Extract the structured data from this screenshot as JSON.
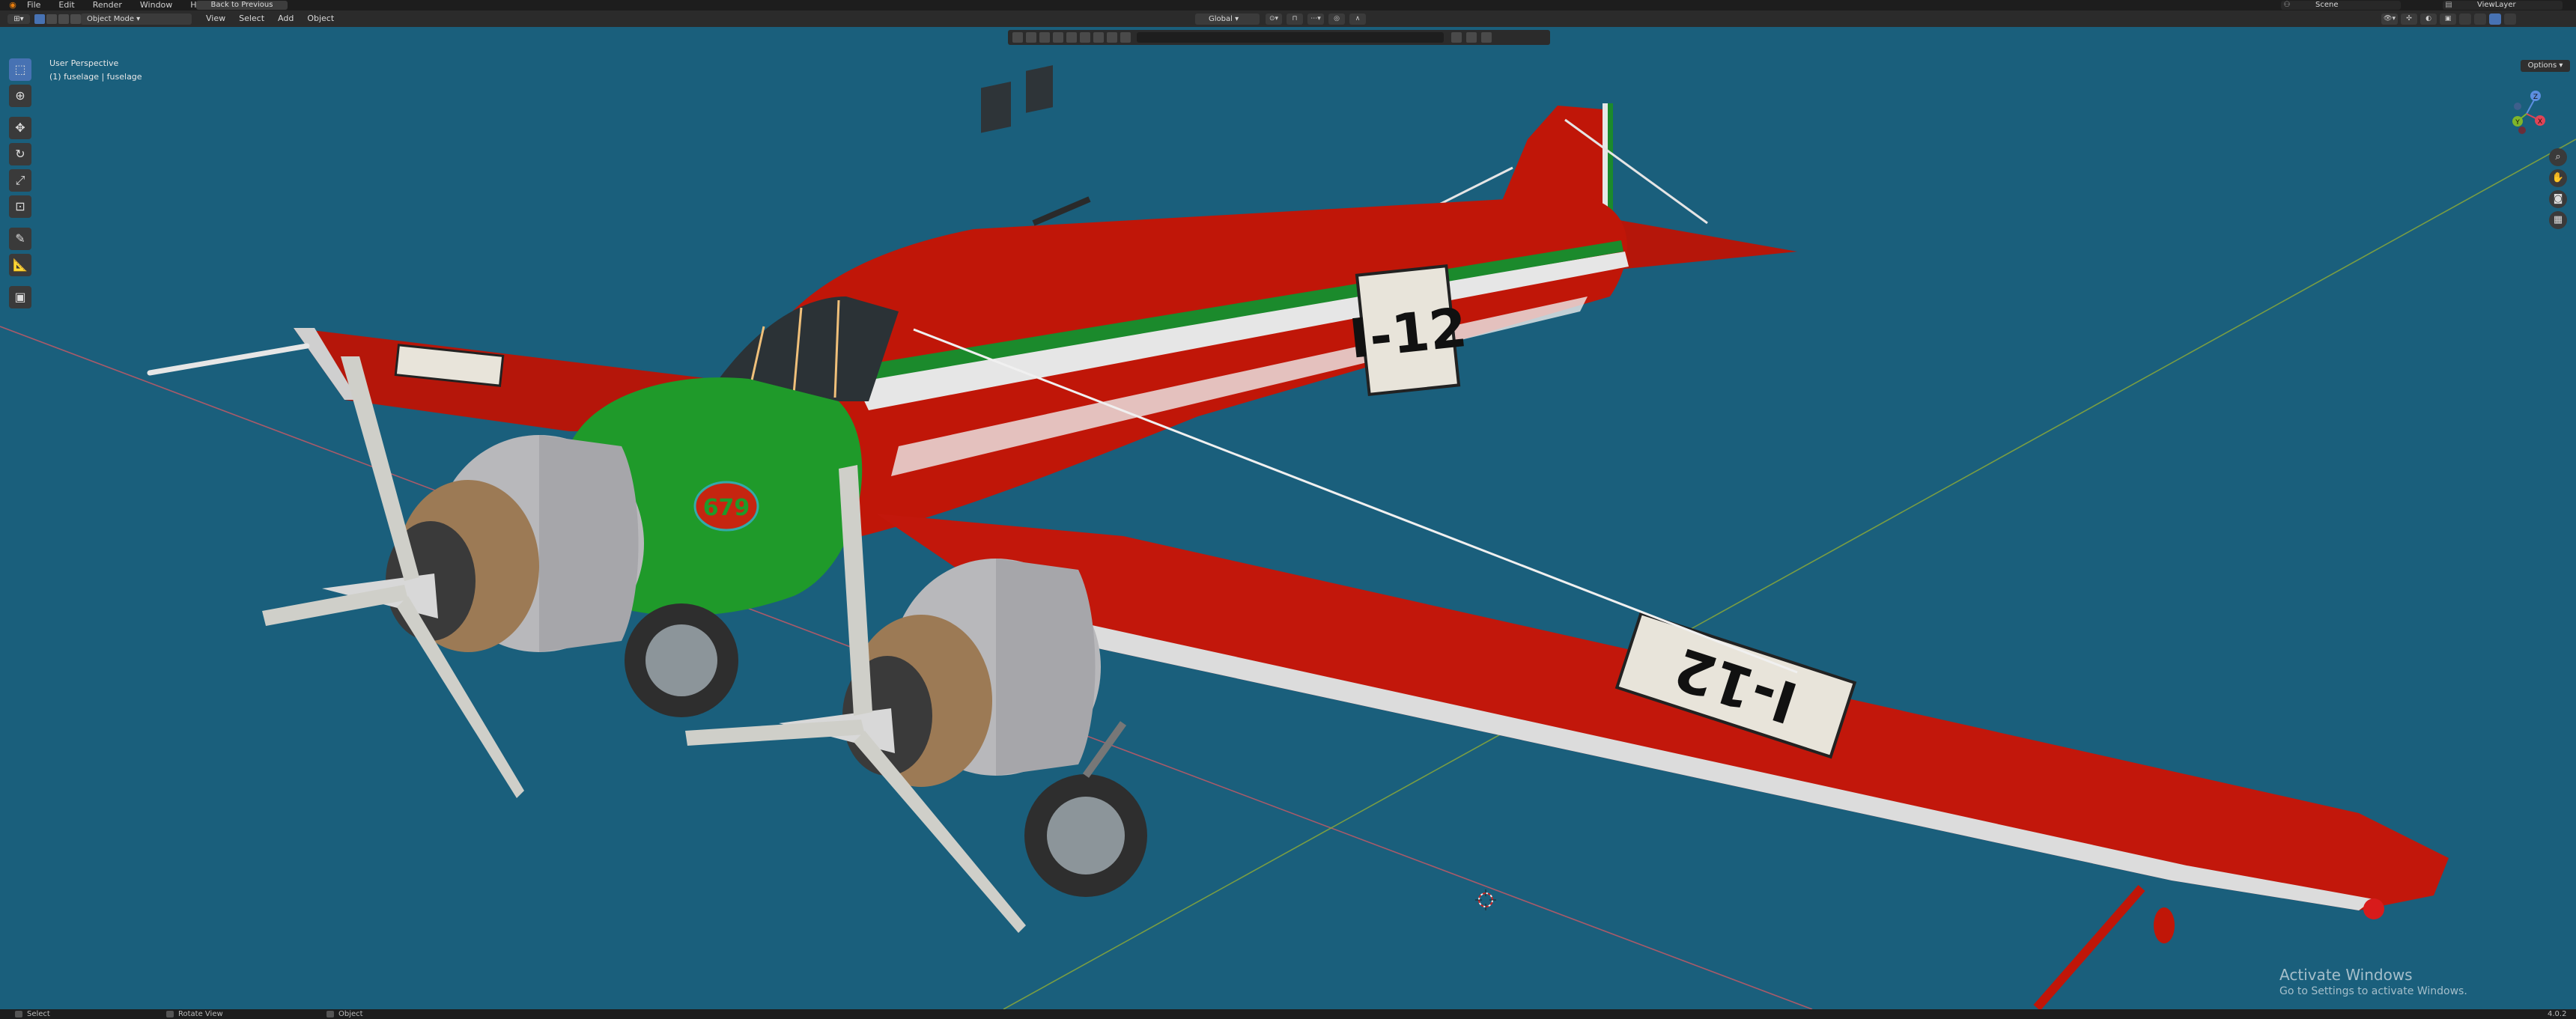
{
  "topbar": {
    "logo": "blender-icon",
    "menus": [
      "File",
      "Edit",
      "Render",
      "Window",
      "Help"
    ],
    "back_button": "Back to Previous",
    "scene": "Scene",
    "view_layer": "ViewLayer"
  },
  "header": {
    "mode": "Object Mode",
    "menus": [
      "View",
      "Select",
      "Add",
      "Object"
    ],
    "transform_orientation": "Global"
  },
  "outliner_filter": {
    "search_placeholder": ""
  },
  "viewport": {
    "view_name": "User Perspective",
    "active_object": "(1) fuselage | fuselage",
    "options_label": "Options",
    "gizmo_axes": [
      "X",
      "Y",
      "Z"
    ],
    "background_color": "#1a5f7c"
  },
  "aircraft": {
    "fuselage_registration": "I-12",
    "wing_registration": "I-12",
    "cowl_marking": "679",
    "colors": {
      "fuselage": "#c01608",
      "nose": "#1f9a2a",
      "stripe_green": "#1b8a2c",
      "cowling": "#b8b8bb",
      "wing_edge": "#d8d8d8"
    }
  },
  "toolbar": {
    "tools": [
      "select-box-icon",
      "cursor-icon",
      "move-icon",
      "rotate-icon",
      "scale-icon",
      "transform-icon",
      "annotate-icon",
      "measure-icon",
      "add-cube-icon"
    ]
  },
  "watermark": {
    "title": "Activate Windows",
    "subtitle": "Go to Settings to activate Windows."
  },
  "statusbar": {
    "items": [
      "Select",
      "Rotate View",
      "Object"
    ],
    "version": "4.0.2"
  }
}
